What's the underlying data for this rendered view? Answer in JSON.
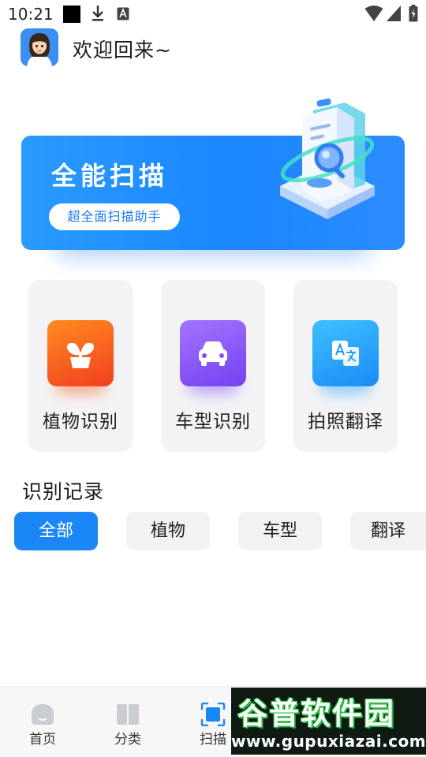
{
  "status_bar": {
    "time": "10:21",
    "icons": [
      "notification-square-icon",
      "download-icon",
      "font-a-icon",
      "wifi-icon",
      "cellular-icon",
      "battery-icon"
    ]
  },
  "header": {
    "avatar": "avatar-girl",
    "welcome_text": "欢迎回来~"
  },
  "banner": {
    "title": "全能扫描",
    "pill_text": "超全面扫描助手",
    "illustration": "document-scan-illustration",
    "gradient": [
      "#2a9bff",
      "#1b86ff"
    ]
  },
  "features": [
    {
      "label": "植物识别",
      "icon": "plant-icon",
      "gradient": [
        "#ff7a1a",
        "#f4431f"
      ]
    },
    {
      "label": "车型识别",
      "icon": "car-icon",
      "gradient": [
        "#9a6bff",
        "#7b44f5"
      ]
    },
    {
      "label": "拍照翻译",
      "icon": "translate-icon",
      "gradient": [
        "#34b4ff",
        "#1a8df5"
      ]
    }
  ],
  "records": {
    "title": "识别记录",
    "filters": [
      {
        "label": "全部",
        "active": true
      },
      {
        "label": "植物",
        "active": false
      },
      {
        "label": "车型",
        "active": false
      },
      {
        "label": "翻译",
        "active": false
      }
    ]
  },
  "bottom_nav": [
    {
      "label": "首页",
      "icon": "home-icon"
    },
    {
      "label": "分类",
      "icon": "book-icon"
    },
    {
      "label": "扫描",
      "icon": "scan-icon"
    }
  ],
  "watermark": {
    "title": "谷普软件园",
    "url": "www.gupuxiazai.com"
  },
  "colors": {
    "accent": "#1b86f5",
    "card_bg": "#f3f3f5",
    "chip_bg": "#f2f2f3"
  }
}
